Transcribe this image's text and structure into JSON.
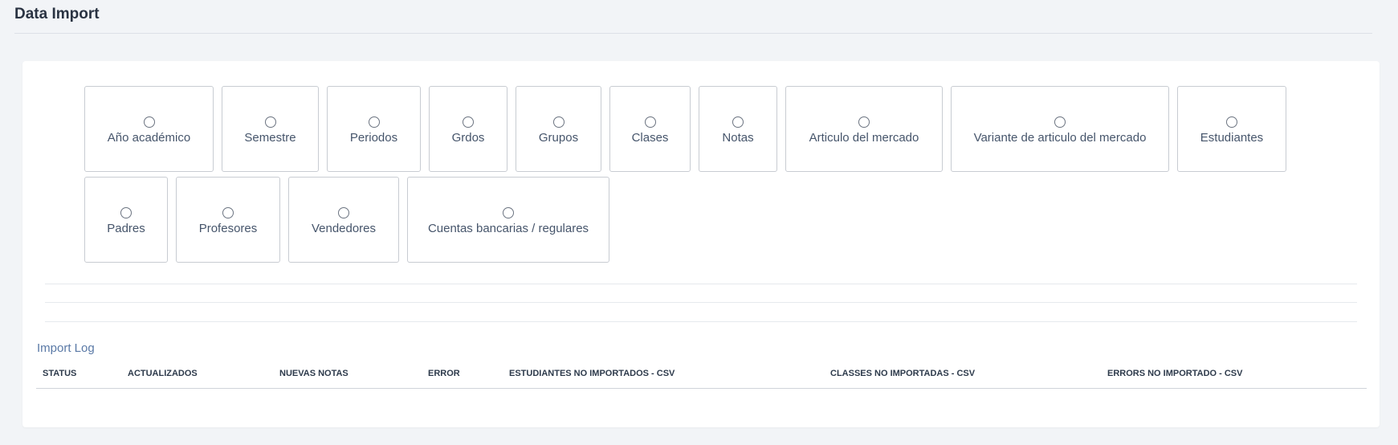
{
  "header": {
    "title": "Data Import"
  },
  "import_types": {
    "row1": [
      "Año académico",
      "Semestre",
      "Periodos",
      "Grdos",
      "Grupos",
      "Clases",
      "Notas",
      "Articulo del mercado",
      "Variante de articulo del mercado",
      "Estudiantes"
    ],
    "row2": [
      "Padres",
      "Profesores",
      "Vendedores",
      "Cuentas bancarias / regulares"
    ]
  },
  "import_log": {
    "title": "Import Log",
    "columns": [
      "STATUS",
      "ACTUALIZADOS",
      "NUEVAS NOTAS",
      "ERROR",
      "ESTUDIANTES NO IMPORTADOS - CSV",
      "CLASSES NO IMPORTADAS - CSV",
      "ERRORS NO IMPORTADO - CSV"
    ],
    "rows": []
  }
}
